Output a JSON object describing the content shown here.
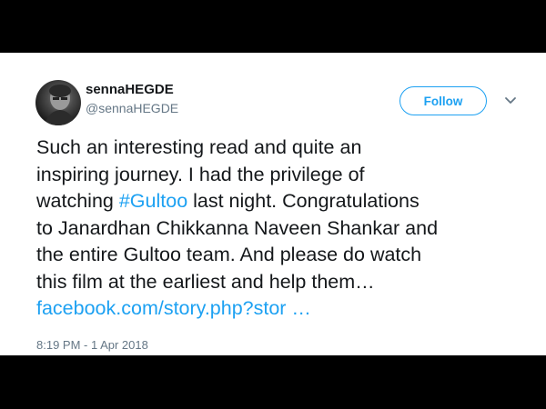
{
  "author": {
    "display_name": "sennaHEGDE",
    "handle": "@sennaHEGDE"
  },
  "actions": {
    "follow_label": "Follow",
    "more_icon": "chevron-down-icon"
  },
  "tweet": {
    "text_before_hashtag": "Such an interesting read and quite an\ninspiring journey. I had the privilege of\nwatching ",
    "hashtag": "#Gultoo",
    "text_after_hashtag": " last night. Congratulations\nto Janardhan Chikkanna Naveen Shankar and\nthe entire Gultoo team. And please do watch\nthis film at the earliest and help them…\n",
    "link": "facebook.com/story.php?stor …",
    "timestamp": "8:19 PM - 1 Apr 2018"
  },
  "colors": {
    "accent": "#1da1f2",
    "text": "#14171a",
    "secondary": "#657786",
    "frame": "#000000"
  }
}
